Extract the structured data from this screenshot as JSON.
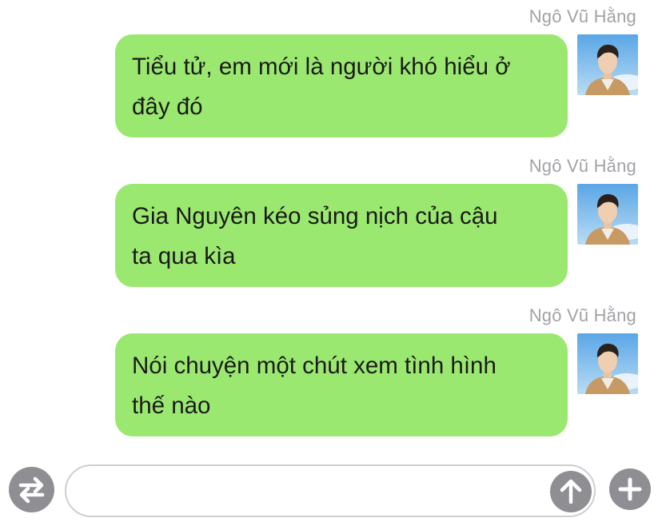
{
  "messages": [
    {
      "sender": "Ngô Vũ Hằng",
      "lines": [
        "Tiểu tử, em mới là người khó hiểu ở",
        "đây đó"
      ]
    },
    {
      "sender": "Ngô Vũ Hằng",
      "lines": [
        "Gia Nguyên kéo sủng nịch của cậu",
        "ta qua kìa"
      ]
    },
    {
      "sender": "Ngô Vũ Hằng",
      "lines": [
        "Nói chuyện một chút xem tình hình",
        "thế nào"
      ]
    }
  ],
  "input": {
    "value": "",
    "placeholder": ""
  },
  "icons": {
    "left": "switch-arrows-icon",
    "send": "arrow-up-icon",
    "add": "plus-icon"
  },
  "colors": {
    "bubble": "#9be870",
    "sender_text": "#a2a2a7",
    "icon_button": "#8e8e93",
    "field_border": "#cfcfd2"
  }
}
